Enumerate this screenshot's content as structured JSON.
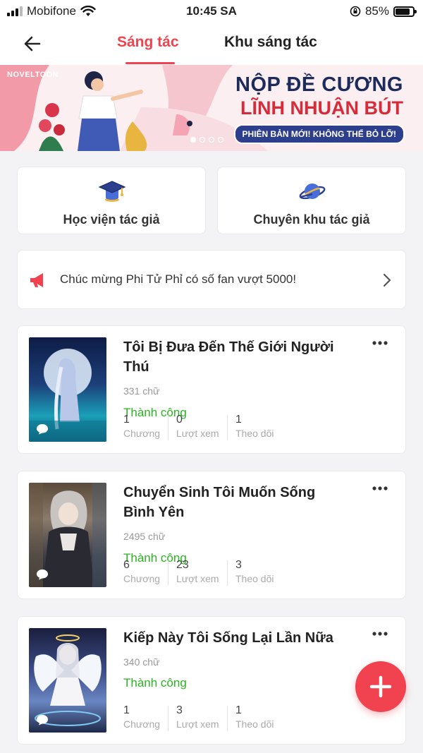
{
  "status_bar": {
    "carrier": "Mobifone",
    "time": "10:45 SA",
    "battery": "85%"
  },
  "header": {
    "tabs": [
      {
        "label": "Sáng tác",
        "active": true
      },
      {
        "label": "Khu sáng tác",
        "active": false
      }
    ]
  },
  "banner": {
    "logo": "NOVELTOON",
    "line1": "NỘP ĐỀ CƯƠNG",
    "line2": "LĨNH NHUẬN BÚT",
    "pill": "PHIÊN BẢN MỚI! KHÔNG THỂ BỎ LỠ!",
    "page_count": 4,
    "active_page": 1
  },
  "quick_links": [
    {
      "label": "Học viện tác giả",
      "icon": "graduation-cap-icon"
    },
    {
      "label": "Chuyên khu tác giả",
      "icon": "planet-icon"
    }
  ],
  "notice": {
    "text": "Chúc mừng Phi Tử Phỉ có số fan vượt 5000!",
    "icon": "megaphone-icon"
  },
  "books": [
    {
      "title": "Tôi Bị Đưa Đến Thế Giới Người Thú",
      "words": "331 chữ",
      "status": "Thành công",
      "stats": [
        {
          "value": "1",
          "label": "Chương"
        },
        {
          "value": "0",
          "label": "Lượt xem"
        },
        {
          "value": "1",
          "label": "Theo dõi"
        }
      ]
    },
    {
      "title": "Chuyển Sinh Tôi Muốn Sống Bình Yên",
      "words": "2495 chữ",
      "status": "Thành công",
      "stats": [
        {
          "value": "6",
          "label": "Chương"
        },
        {
          "value": "23",
          "label": "Lượt xem"
        },
        {
          "value": "3",
          "label": "Theo dõi"
        }
      ]
    },
    {
      "title": "Kiếp Này Tôi Sống Lại Lần Nữa",
      "words": "340 chữ",
      "status": "Thành công",
      "stats": [
        {
          "value": "1",
          "label": "Chương"
        },
        {
          "value": "3",
          "label": "Lượt xem"
        },
        {
          "value": "1",
          "label": "Theo dõi"
        }
      ]
    }
  ],
  "colors": {
    "accent": "#f0434f",
    "success": "#2ab521"
  }
}
